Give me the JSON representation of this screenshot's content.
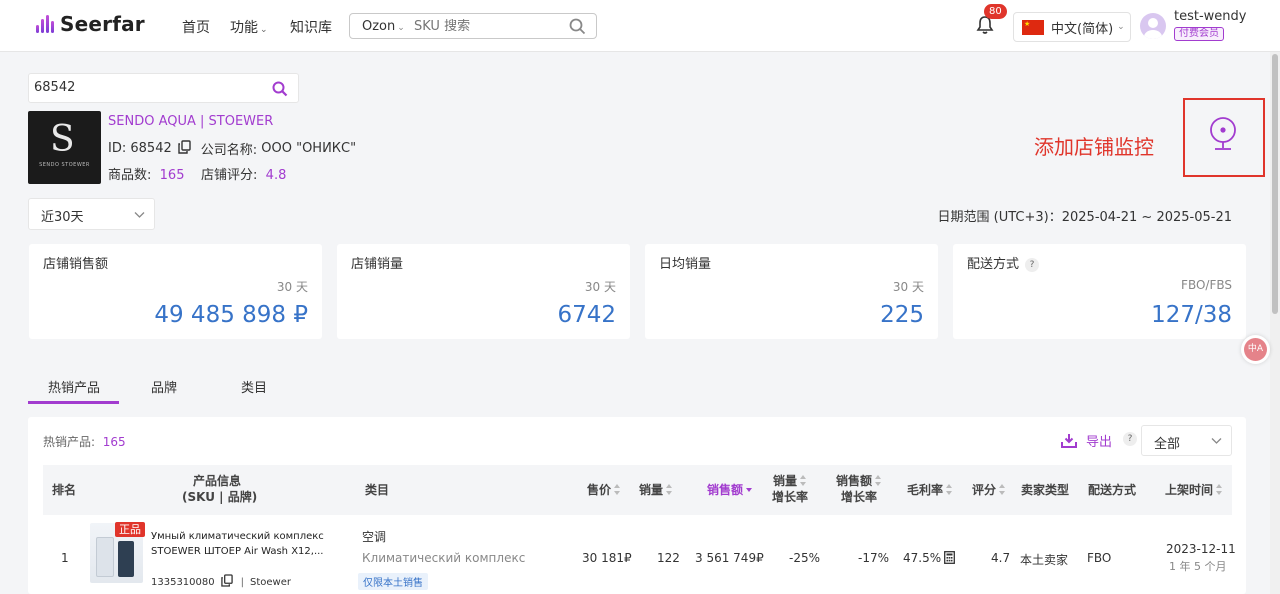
{
  "header": {
    "logo_text": "Seerfar",
    "nav": {
      "home": "首页",
      "features": "功能",
      "knowledge": "知识库"
    },
    "search": {
      "platform": "Ozon",
      "placeholder": "SKU 搜索"
    },
    "notifications": {
      "count": "80"
    },
    "language": "中文(简体)",
    "user": {
      "name": "test-wendy",
      "membership": "付费会员"
    }
  },
  "shop_search": {
    "value": "68542"
  },
  "shop": {
    "logo_letter": "S",
    "logo_caption": "SENDO STOEWER",
    "name": "SENDO AQUA | STOEWER",
    "id_label": "ID:",
    "id": "68542",
    "company_label": "公司名称:",
    "company": "ООО \"ОНИКС\"",
    "products_label": "商品数:",
    "products": "165",
    "rating_label": "店铺评分:",
    "rating": "4.8"
  },
  "monitor": {
    "label": "添加店铺监控"
  },
  "period": {
    "selected": "近30天"
  },
  "date_range": {
    "label": "日期范围 (UTC+3)：",
    "value": "2025-04-21 ~ 2025-05-21"
  },
  "metrics": [
    {
      "title": "店铺销售额",
      "period": "30 天",
      "value": "49 485 898 ₽"
    },
    {
      "title": "店铺销量",
      "period": "30 天",
      "value": "6742"
    },
    {
      "title": "日均销量",
      "period": "30 天",
      "value": "225"
    },
    {
      "title": "配送方式",
      "period": "FBO/FBS",
      "value": "127/38",
      "help": "?"
    }
  ],
  "float_tool": {
    "label": "中A"
  },
  "tabs": [
    {
      "label": "热销产品",
      "active": true
    },
    {
      "label": "品牌",
      "active": false
    },
    {
      "label": "类目",
      "active": false
    }
  ],
  "table": {
    "count_label": "热销产品:",
    "count": "165",
    "export_label": "导出",
    "help": "?",
    "filter": "全部",
    "columns": {
      "rank": "排名",
      "product_info_1": "产品信息",
      "product_info_2": "(SKU | 品牌)",
      "category": "类目",
      "price": "售价",
      "sales": "销量",
      "revenue": "销售额",
      "sales_growth_1": "销量",
      "sales_growth_2": "增长率",
      "revenue_growth_1": "销售额",
      "revenue_growth_2": "增长率",
      "margin": "毛利率",
      "rating": "评分",
      "seller_type": "卖家类型",
      "fulfillment": "配送方式",
      "listed": "上架时间"
    },
    "rows": [
      {
        "rank": "1",
        "badge": "正品",
        "name": "Умный климатический комплекс STOEWER ШТОЕР Air Wash X12,...",
        "sku": "1335310080",
        "brand": "Stoewer",
        "category_cn": "空调",
        "category_ru": "Климатический комплекс",
        "tag": "仅限本土销售",
        "price": "30 181₽",
        "sales": "122",
        "revenue": "3 561 749₽",
        "sales_growth": "-25%",
        "revenue_growth": "-17%",
        "margin": "47.5%",
        "rating": "4.7",
        "seller_type": "本土卖家",
        "fulfillment": "FBO",
        "listed_date": "2023-12-11",
        "listed_age": "1 年 5 个月"
      }
    ]
  }
}
